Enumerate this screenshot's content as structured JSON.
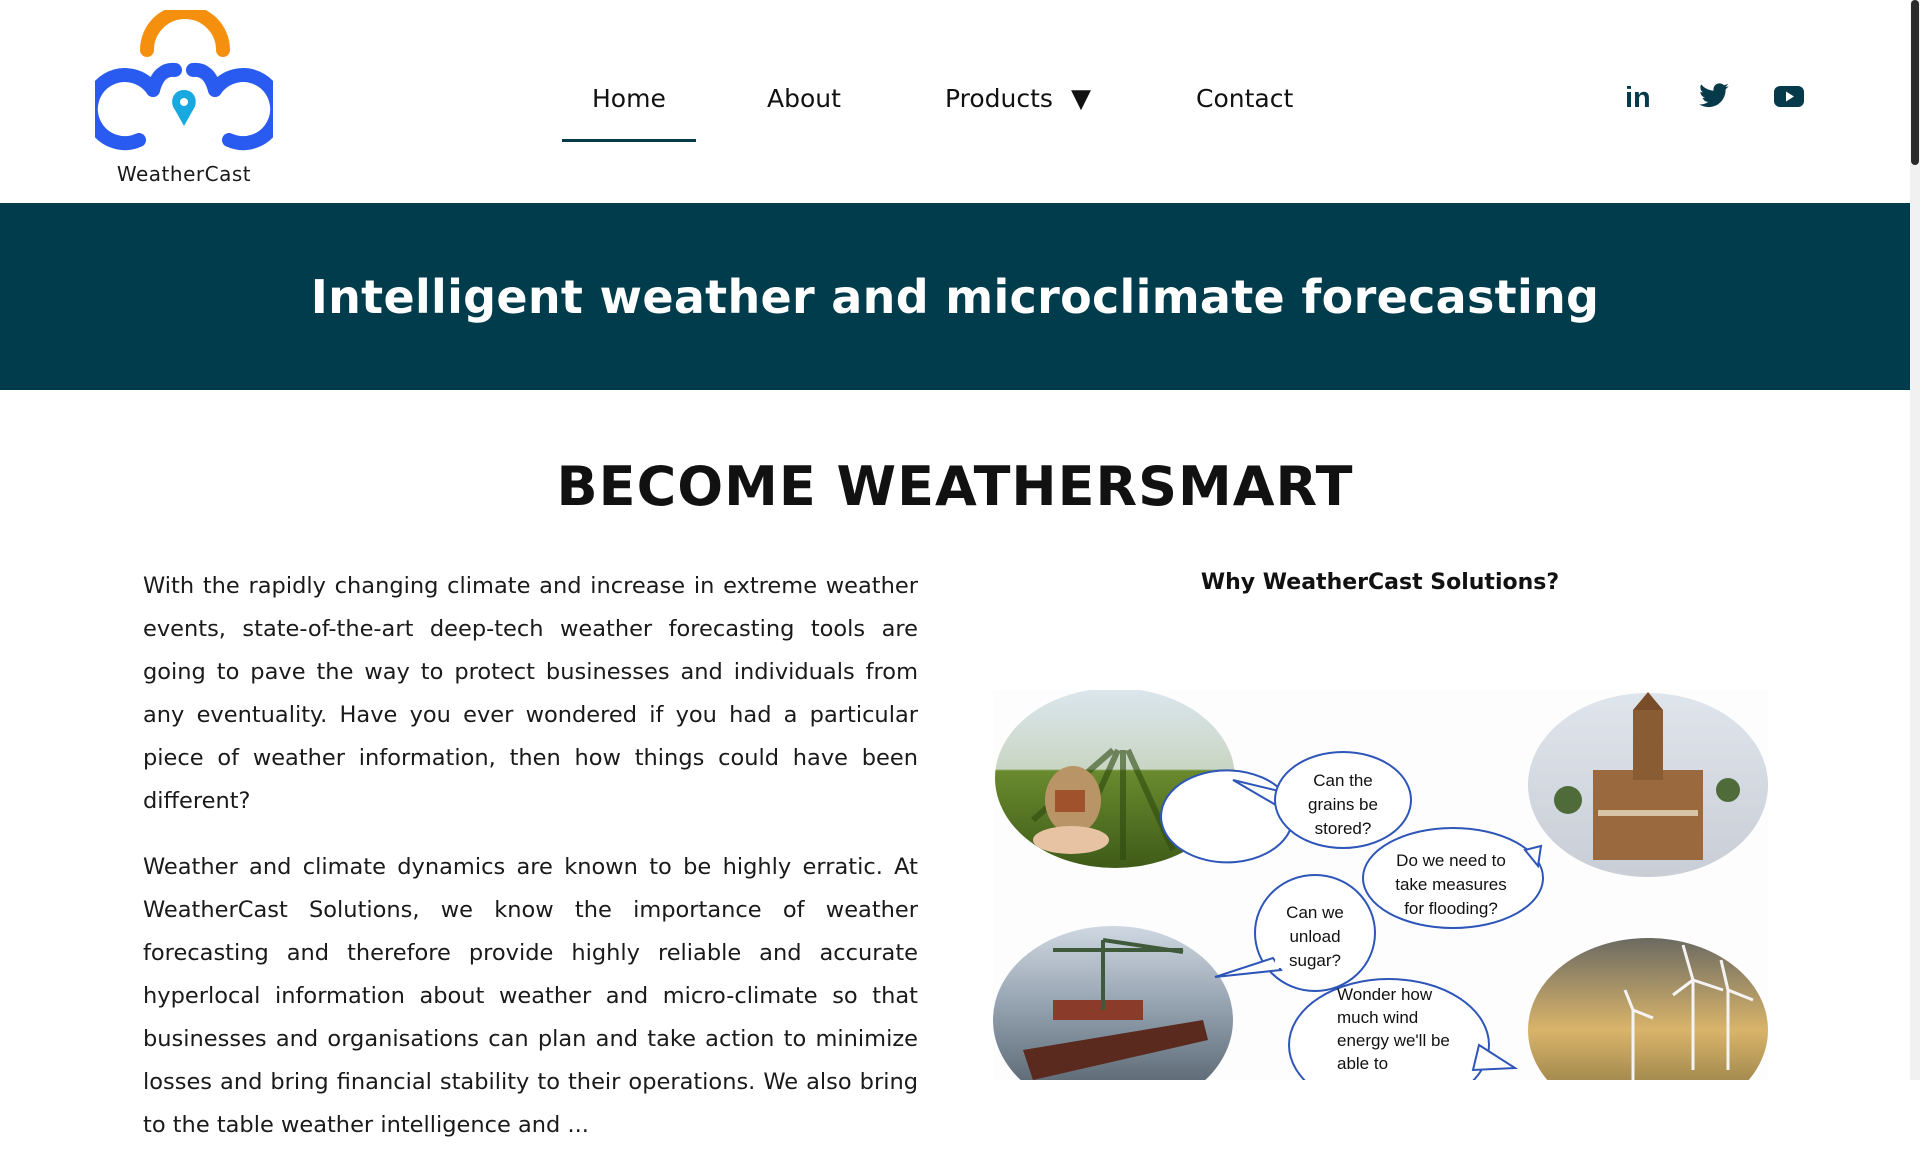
{
  "brand": {
    "name": "WeatherCast"
  },
  "nav": {
    "items": [
      {
        "label": "Home",
        "active": true
      },
      {
        "label": "About"
      },
      {
        "label": "Products",
        "caret": "▼"
      },
      {
        "label": "Contact"
      }
    ]
  },
  "social": {
    "icons": [
      "linkedin-icon",
      "twitter-icon",
      "youtube-icon"
    ],
    "linkedin": "in"
  },
  "banner": {
    "title": "Intelligent weather and microclimate forecasting"
  },
  "section": {
    "title": "BECOME WEATHERSMART",
    "paragraph1": "With the rapidly changing climate and increase in extreme weather events, state-of-the-art deep-tech weather forecasting tools are going to pave the way to protect businesses and individuals from any eventuality. Have you ever wondered if you had a particular piece of weather information, then how things could have been different?",
    "paragraph2": "Weather and climate dynamics are known to be highly erratic. At WeatherCast Solutions, we know the importance of weather forecasting and therefore provide highly reliable and accurate hyperlocal information about weather and micro-climate so that businesses and organisations can plan and take action to minimize losses and bring financial stability to their operations. We also bring to the table weather intelligence and ..."
  },
  "why": {
    "title": "Why WeatherCast Solutions?",
    "bubbles": [
      [
        "Can the",
        "grains be",
        "stored?"
      ],
      [
        "Do we need to",
        "take measures",
        "for flooding?"
      ],
      [
        "Can we",
        "unload",
        "sugar?"
      ],
      [
        "Wonder how",
        "much wind",
        "energy we'll be",
        "able to"
      ]
    ]
  },
  "colors": {
    "primary": "#003c4b",
    "logo_orange": "#f5900f",
    "logo_blue": "#2a5bf0",
    "pin": "#18a9e0",
    "bubble_stroke": "#2e56b8"
  }
}
